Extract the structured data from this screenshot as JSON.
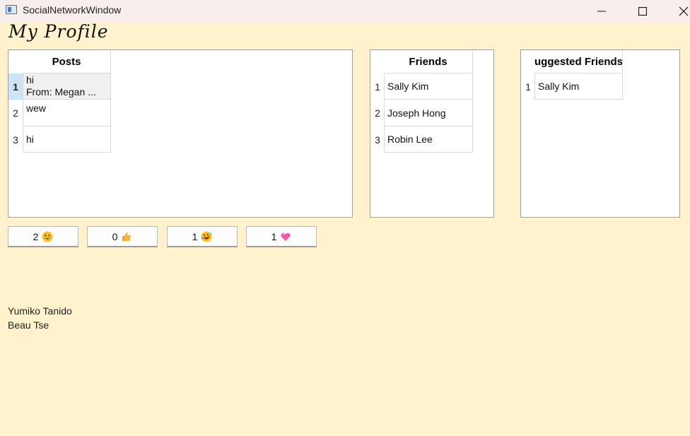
{
  "window": {
    "title": "SocialNetworkWindow"
  },
  "page": {
    "title": "My Profile"
  },
  "posts": {
    "header": "Posts",
    "rows": [
      {
        "index": "1",
        "line1": "hi",
        "line2": "From: Megan ..."
      },
      {
        "index": "2",
        "line1": "wew",
        "line2": ""
      },
      {
        "index": "3",
        "line1": "hi",
        "line2": ""
      }
    ]
  },
  "friends": {
    "header": "Friends",
    "rows": [
      {
        "index": "1",
        "name": "Sally Kim"
      },
      {
        "index": "2",
        "name": "Joseph Hong"
      },
      {
        "index": "3",
        "name": "Robin Lee"
      }
    ]
  },
  "suggested": {
    "header": "Suggested Friends",
    "rows": [
      {
        "index": "1",
        "name": "Sally Kim"
      }
    ]
  },
  "reactions": [
    {
      "count": "2",
      "icon": "grinning-face-icon"
    },
    {
      "count": "0",
      "icon": "thumbs-up-icon"
    },
    {
      "count": "1",
      "icon": "rofl-face-icon"
    },
    {
      "count": "1",
      "icon": "heart-icon"
    }
  ],
  "names": [
    "Yumiko Tanido",
    "Beau Tse"
  ]
}
